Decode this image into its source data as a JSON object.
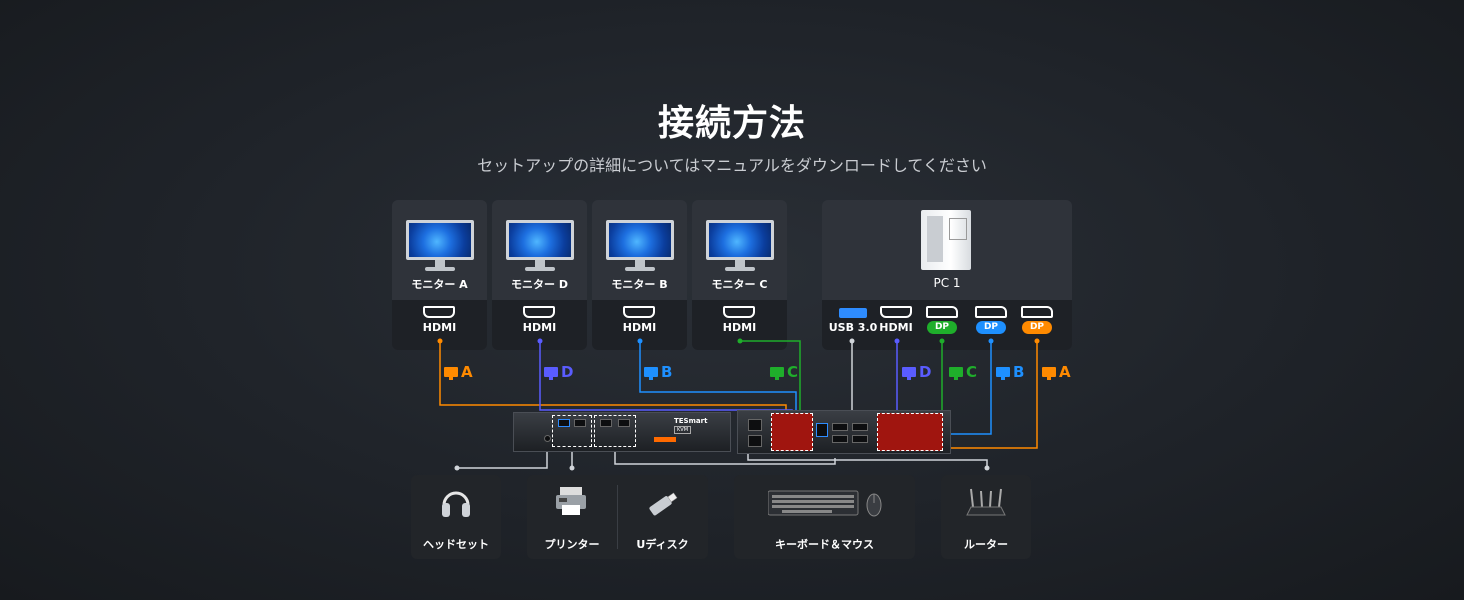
{
  "header": {
    "title": "接続方法",
    "subtitle": "セットアップの詳細についてはマニュアルをダウンロードしてください"
  },
  "monitors": [
    {
      "label": "モニター A",
      "port": "HDMI"
    },
    {
      "label": "モニター D",
      "port": "HDMI"
    },
    {
      "label": "モニター B",
      "port": "HDMI"
    },
    {
      "label": "モニター C",
      "port": "HDMI"
    }
  ],
  "pc": {
    "label": "PC 1",
    "ports": [
      {
        "label": "USB 3.0"
      },
      {
        "label": "HDMI"
      },
      {
        "label": "DP",
        "color": "#1fae2b"
      },
      {
        "label": "DP",
        "color": "#1e90ff"
      },
      {
        "label": "DP",
        "color": "#ff8a00"
      }
    ]
  },
  "kvm": {
    "brand": "TESmart",
    "model": "KVM"
  },
  "cable_tags": [
    {
      "letter": "A",
      "color": "#ff8a00"
    },
    {
      "letter": "D",
      "color": "#5a5cff"
    },
    {
      "letter": "B",
      "color": "#1e90ff"
    },
    {
      "letter": "C",
      "color": "#1fae2b"
    },
    {
      "letter": "D",
      "color": "#5a5cff"
    },
    {
      "letter": "C",
      "color": "#1fae2b"
    },
    {
      "letter": "B",
      "color": "#1e90ff"
    },
    {
      "letter": "A",
      "color": "#ff8a00"
    }
  ],
  "devices": [
    {
      "label": "ヘッドセット",
      "icon": "headset-icon"
    },
    {
      "label": "プリンター",
      "icon": "printer-icon"
    },
    {
      "label": "Uディスク",
      "icon": "usb-drive-icon"
    },
    {
      "label": "キーボード＆マウス",
      "icon": "keyboard-mouse-icon"
    },
    {
      "label": "ルーター",
      "icon": "router-icon"
    }
  ]
}
